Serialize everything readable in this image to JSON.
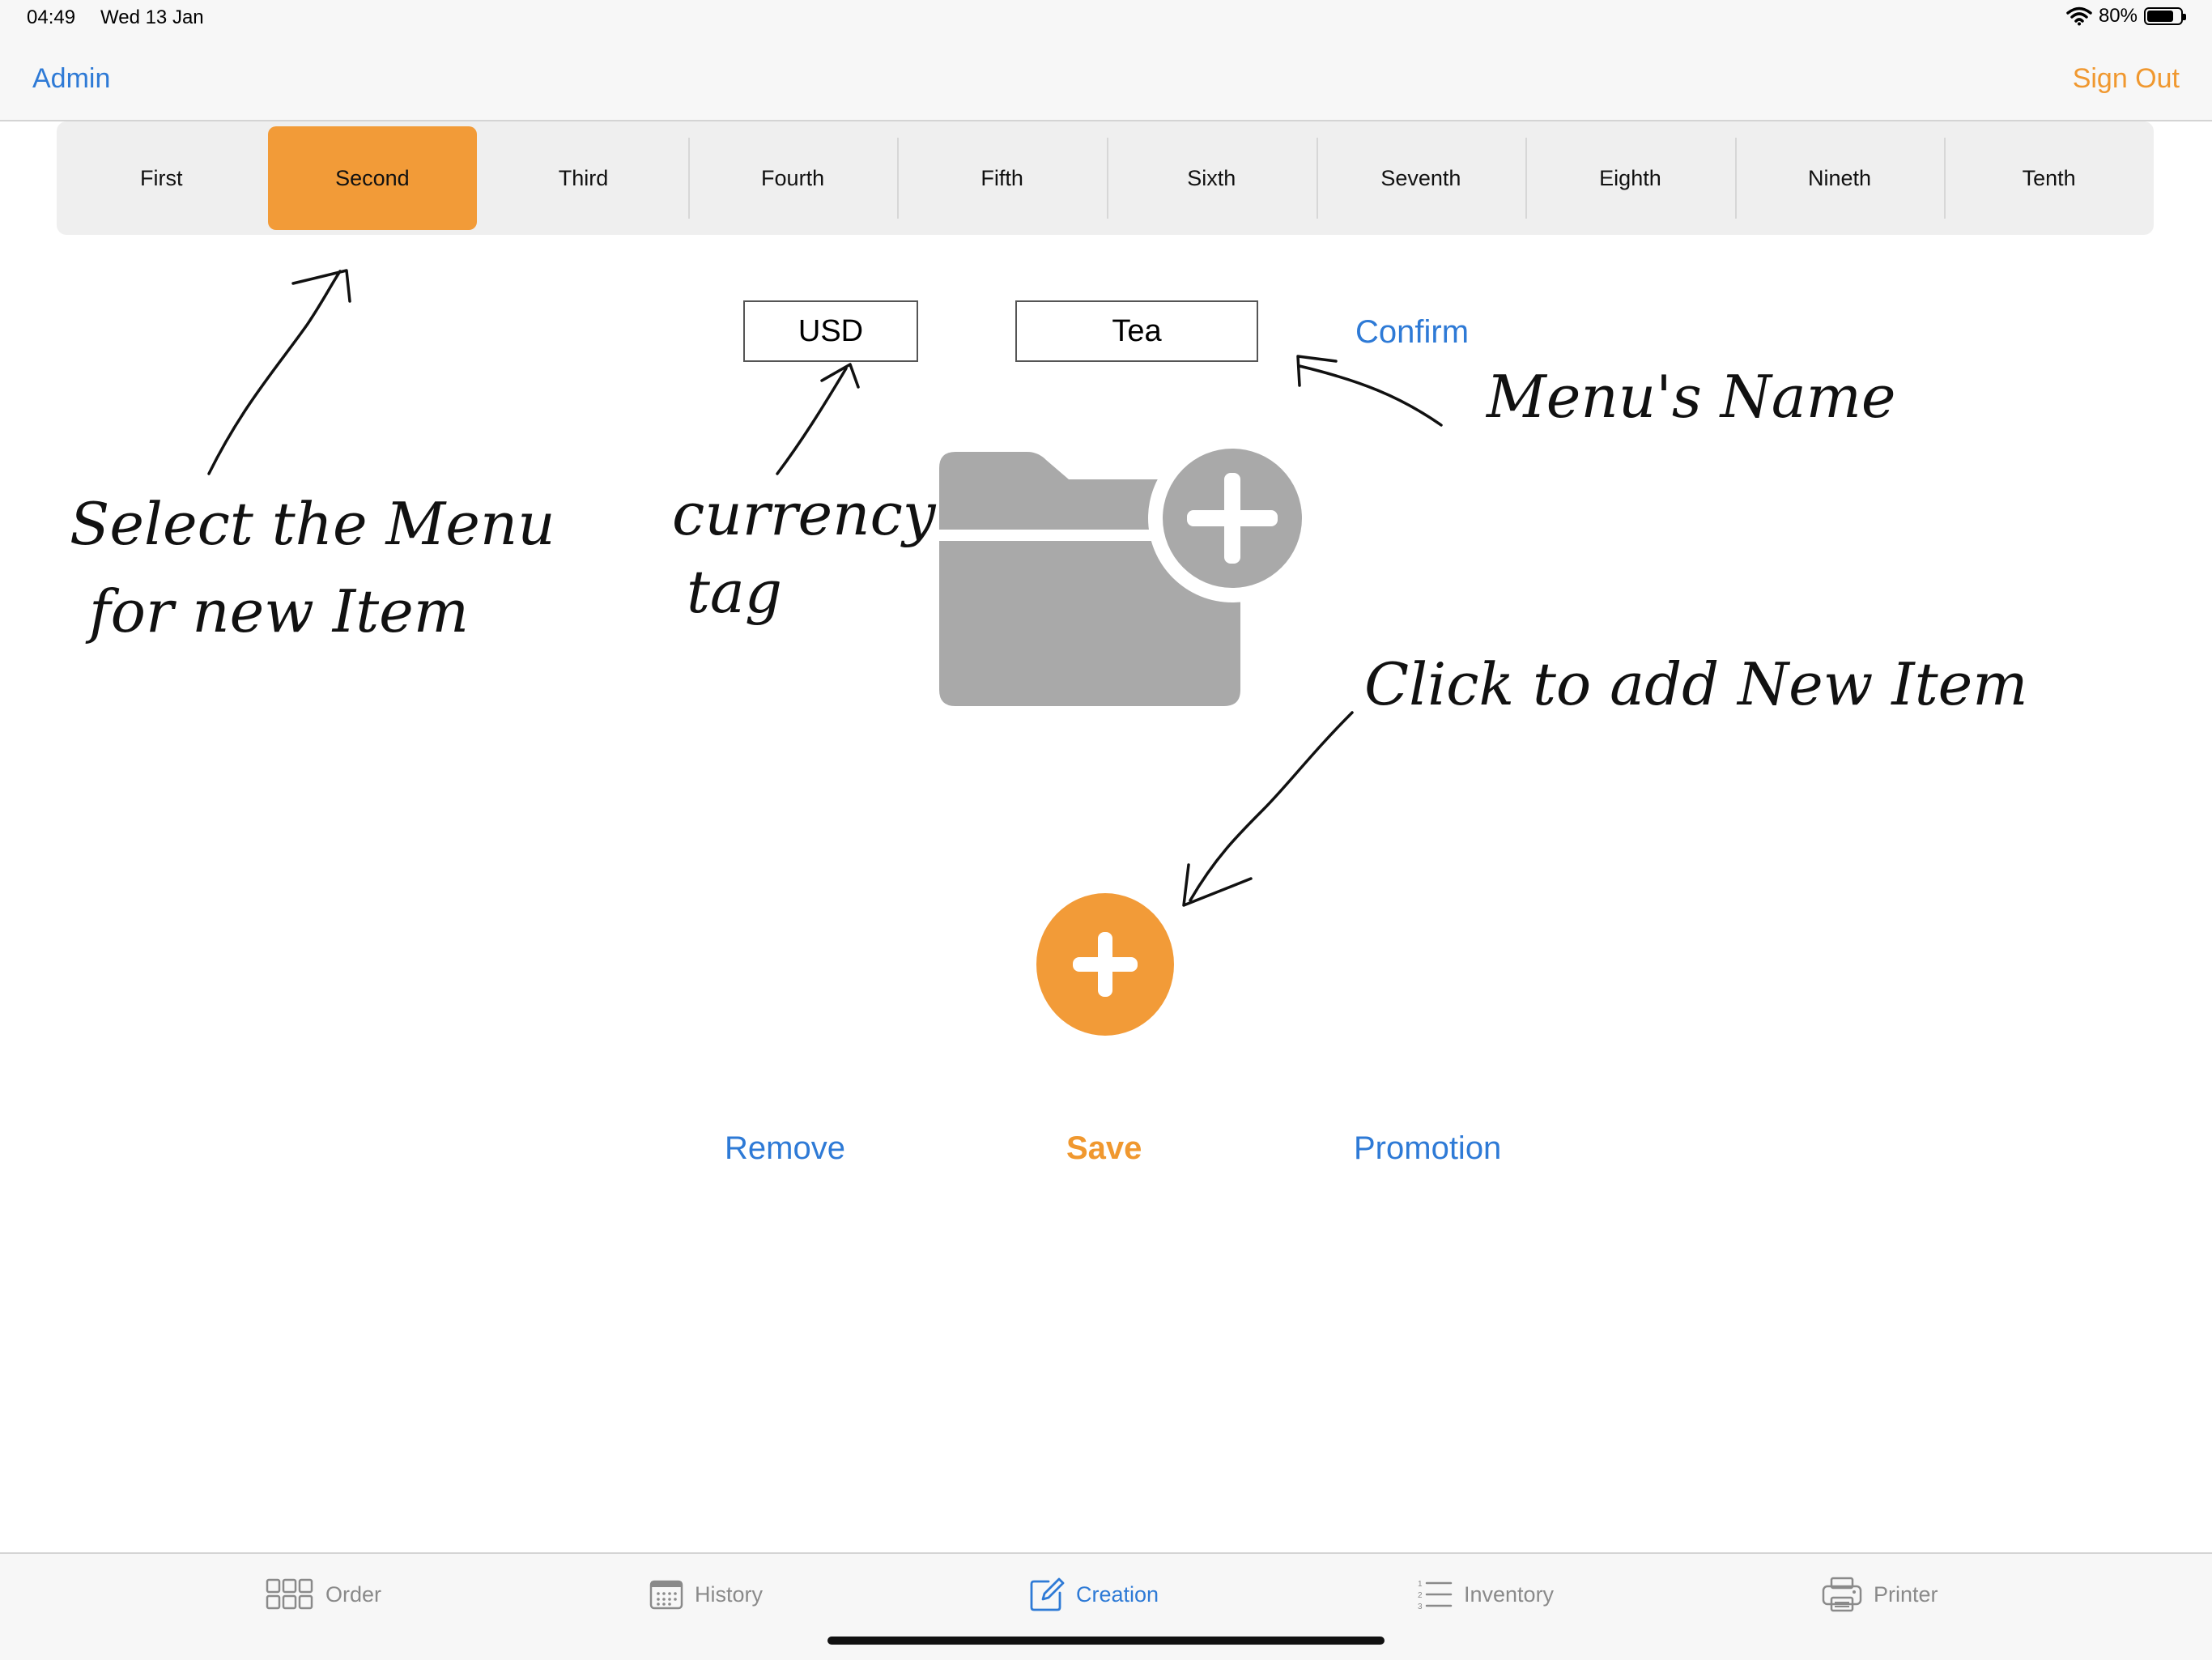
{
  "status": {
    "time": "04:49",
    "date": "Wed 13 Jan",
    "battery_text": "80%",
    "battery_level": 0.8
  },
  "nav": {
    "left": "Admin",
    "right": "Sign Out"
  },
  "segments": {
    "items": [
      "First",
      "Second",
      "Third",
      "Fourth",
      "Fifth",
      "Sixth",
      "Seventh",
      "Eighth",
      "Nineth",
      "Tenth"
    ],
    "selected_index": 1
  },
  "form": {
    "currency_value": "USD",
    "name_value": "Tea",
    "confirm_label": "Confirm"
  },
  "icons": {
    "folder": "folder-add-icon",
    "add": "plus-icon",
    "wifi": "wifi-icon",
    "battery": "battery-icon"
  },
  "actions": {
    "remove": "Remove",
    "save": "Save",
    "promotion": "Promotion"
  },
  "annotations": {
    "select_line1": "Select the Menu",
    "select_line2": "for new Item",
    "currency_line1": "currency",
    "currency_line2": "tag",
    "menu_name": "Menu's Name",
    "click_add": "Click to add New Item"
  },
  "tabs": [
    {
      "label": "Order",
      "icon": "grid-icon"
    },
    {
      "label": "History",
      "icon": "calendar-icon"
    },
    {
      "label": "Creation",
      "icon": "compose-icon"
    },
    {
      "label": "Inventory",
      "icon": "list-icon"
    },
    {
      "label": "Printer",
      "icon": "printer-icon"
    }
  ],
  "colors": {
    "accent_orange": "#f29b38",
    "link_blue": "#2e7ad6",
    "icon_gray": "#a9a9a9"
  }
}
